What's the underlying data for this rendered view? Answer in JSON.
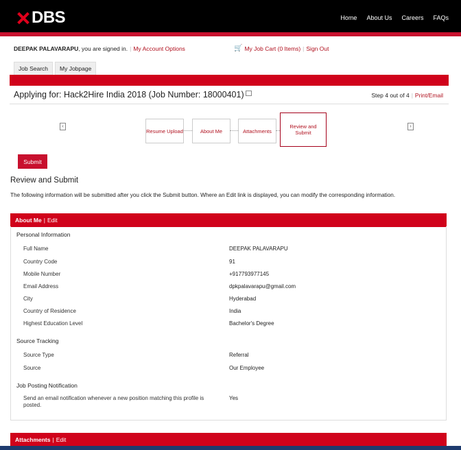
{
  "header": {
    "logo": "DBS",
    "nav": [
      "Home",
      "About Us",
      "Careers",
      "FAQs"
    ]
  },
  "user": {
    "name": "DEEPAK PALAVARAPU",
    "signed_in": ", you are signed in.",
    "account_options": "My Account Options"
  },
  "cart": {
    "label": "My Job Cart (0 Items)",
    "signout": "Sign Out"
  },
  "tabs": [
    "Job Search",
    "My Jobpage"
  ],
  "applying": {
    "text": "Applying for:  Hack2Hire India 2018 (Job Number: 18000401)",
    "step": "Step 4 out of 4",
    "print": "Print/Email"
  },
  "wizard": {
    "steps": [
      "Resume Upload",
      "About Me",
      "Attachments",
      "Review and Submit"
    ]
  },
  "submit_button": "Submit",
  "review": {
    "title": "Review and Submit",
    "description": "The following information will be submitted after you click the Submit button. Where an Edit link is displayed, you can modify the corresponding information."
  },
  "about_me": {
    "header": "About Me",
    "edit": "Edit",
    "personal_title": "Personal Information",
    "fields": [
      {
        "label": "Full Name",
        "value": "DEEPAK PALAVARAPU"
      },
      {
        "label": "Country Code",
        "value": "91"
      },
      {
        "label": "Mobile Number",
        "value": "+917793977145"
      },
      {
        "label": "Email Address",
        "value": "dpkpalavarapu@gmail.com"
      },
      {
        "label": "City",
        "value": "Hyderabad"
      },
      {
        "label": "Country of Residence",
        "value": "India"
      },
      {
        "label": "Highest Education Level",
        "value": "Bachelor's Degree"
      }
    ],
    "source_title": "Source Tracking",
    "source_fields": [
      {
        "label": "Source Type",
        "value": "Referral"
      },
      {
        "label": "Source",
        "value": "Our Employee"
      }
    ],
    "notification_title": "Job Posting Notification",
    "notification": {
      "label": "Send an email notification whenever a new position matching this profile is posted.",
      "value": "Yes"
    }
  },
  "attachments": {
    "header": "Attachments",
    "edit": "Edit"
  },
  "colors": {
    "brand_red": "#d0021b",
    "header_black": "#000000"
  }
}
